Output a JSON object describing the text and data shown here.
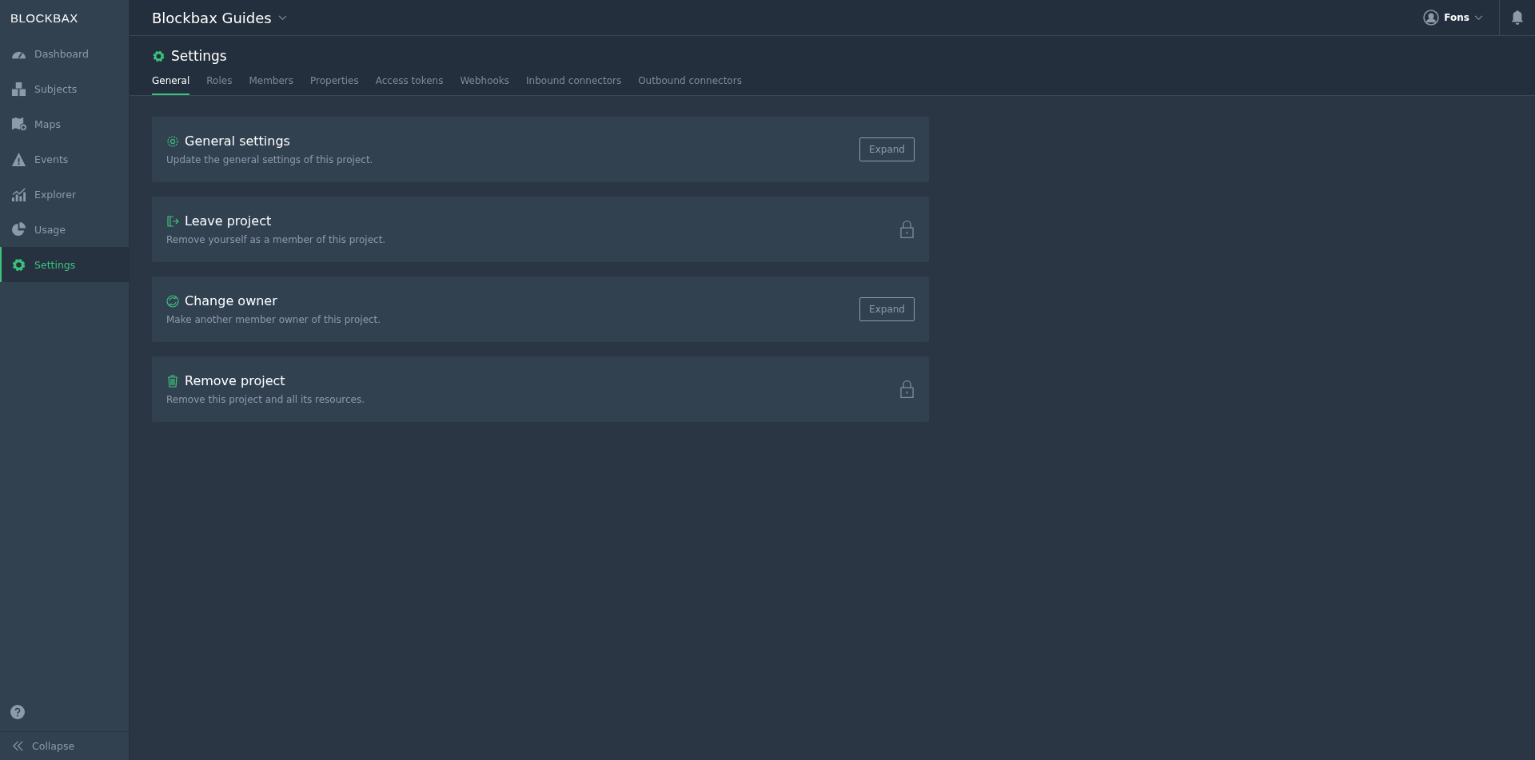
{
  "logo": "BLOCKBAX",
  "sidebar": {
    "items": [
      {
        "label": "Dashboard",
        "selected": false
      },
      {
        "label": "Subjects",
        "selected": false
      },
      {
        "label": "Maps",
        "selected": false
      },
      {
        "label": "Events",
        "selected": false
      },
      {
        "label": "Explorer",
        "selected": false
      },
      {
        "label": "Usage",
        "selected": false
      },
      {
        "label": "Settings",
        "selected": true
      }
    ],
    "collapse": "Collapse"
  },
  "header": {
    "project": "Blockbax Guides",
    "user": "Fons"
  },
  "page": {
    "title": "Settings",
    "tabs": [
      {
        "label": "General",
        "selected": true
      },
      {
        "label": "Roles",
        "selected": false
      },
      {
        "label": "Members",
        "selected": false
      },
      {
        "label": "Properties",
        "selected": false
      },
      {
        "label": "Access tokens",
        "selected": false
      },
      {
        "label": "Webhooks",
        "selected": false
      },
      {
        "label": "Inbound connectors",
        "selected": false
      },
      {
        "label": "Outbound connectors",
        "selected": false
      }
    ],
    "sections": [
      {
        "title": "General settings",
        "description": "Update the general settings of this project.",
        "kind": "button",
        "action": "Expand"
      },
      {
        "title": "Leave project",
        "description": "Remove yourself as a member of this project.",
        "kind": "locked"
      },
      {
        "title": "Change owner",
        "description": "Make another member owner of this project.",
        "kind": "button",
        "action": "Expand"
      },
      {
        "title": "Remove project",
        "description": "Remove this project and all its resources.",
        "kind": "locked"
      }
    ]
  }
}
